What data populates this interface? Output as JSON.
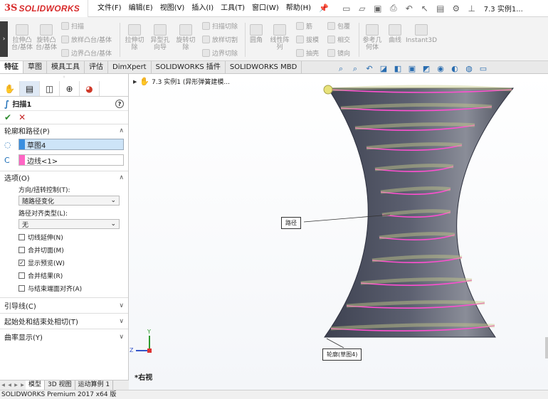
{
  "app": {
    "logo_ds": "3S",
    "logo_name": "SOLIDWORKS",
    "doc_title": "7.3 实例1..."
  },
  "menu": [
    "文件(F)",
    "编辑(E)",
    "视图(V)",
    "插入(I)",
    "工具(T)",
    "窗口(W)",
    "帮助(H)"
  ],
  "ribbon": {
    "extrude_boss": "拉伸凸台/基体",
    "revolve_boss": "旋转凸台/基体",
    "sweep": "扫描",
    "loft": "放样凸台/基体",
    "boundary_boss": "边界凸台/基体",
    "extrude_cut": "拉伸切除",
    "hole_wizard": "异型孔向导",
    "revolve_cut": "旋转切除",
    "swept_cut": "扫描切除",
    "lofted_cut": "放样切割",
    "boundary_cut": "边界切除",
    "fillet": "圆角",
    "linear_pattern": "线性阵列",
    "rib": "筋",
    "draft": "拔模",
    "shell": "抽壳",
    "wrap": "包覆",
    "intersect": "相交",
    "mirror": "镜向",
    "ref_geometry": "参考几何体",
    "curves": "曲线",
    "instant3d": "Instant3D"
  },
  "tabs": [
    "特征",
    "草图",
    "模具工具",
    "评估",
    "DimXpert",
    "SOLIDWORKS 插件",
    "SOLIDWORKS MBD"
  ],
  "tree_flyout": "7.3 实例1 (异形弹簧建模...",
  "property_manager": {
    "title": "扫描1",
    "profile_section": "轮廓和路径(P)",
    "profile_value": "草图4",
    "path_value": "边线<1>",
    "options_section": "选项(O)",
    "orientation_label": "方向/扭转控制(T):",
    "orientation_value": "随路径变化",
    "path_align_label": "路径对齐类型(L):",
    "path_align_value": "无",
    "checkboxes": [
      {
        "label": "切线延伸(N)",
        "checked": false
      },
      {
        "label": "合并切面(M)",
        "checked": false
      },
      {
        "label": "显示预览(W)",
        "checked": true
      },
      {
        "label": "合并结果(R)",
        "checked": false
      },
      {
        "label": "与结束端面对齐(A)",
        "checked": false
      }
    ],
    "guide_section": "引导线(C)",
    "tangency_section": "起始处和结束处相切(T)",
    "curvature_section": "曲率显示(Y)"
  },
  "callouts": {
    "path": "路径",
    "profile": "轮廓(草图4)"
  },
  "view_name": "*右视",
  "bottom_tabs": [
    "模型",
    "3D 视图",
    "运动算例 1"
  ],
  "status": "SOLIDWORKS Premium 2017 x64 版",
  "axis": {
    "y": "Y",
    "z": "Z"
  },
  "colors": {
    "accent": "#d82b2b",
    "spring": "#ff4fd0",
    "body": "#4b4f5c"
  }
}
